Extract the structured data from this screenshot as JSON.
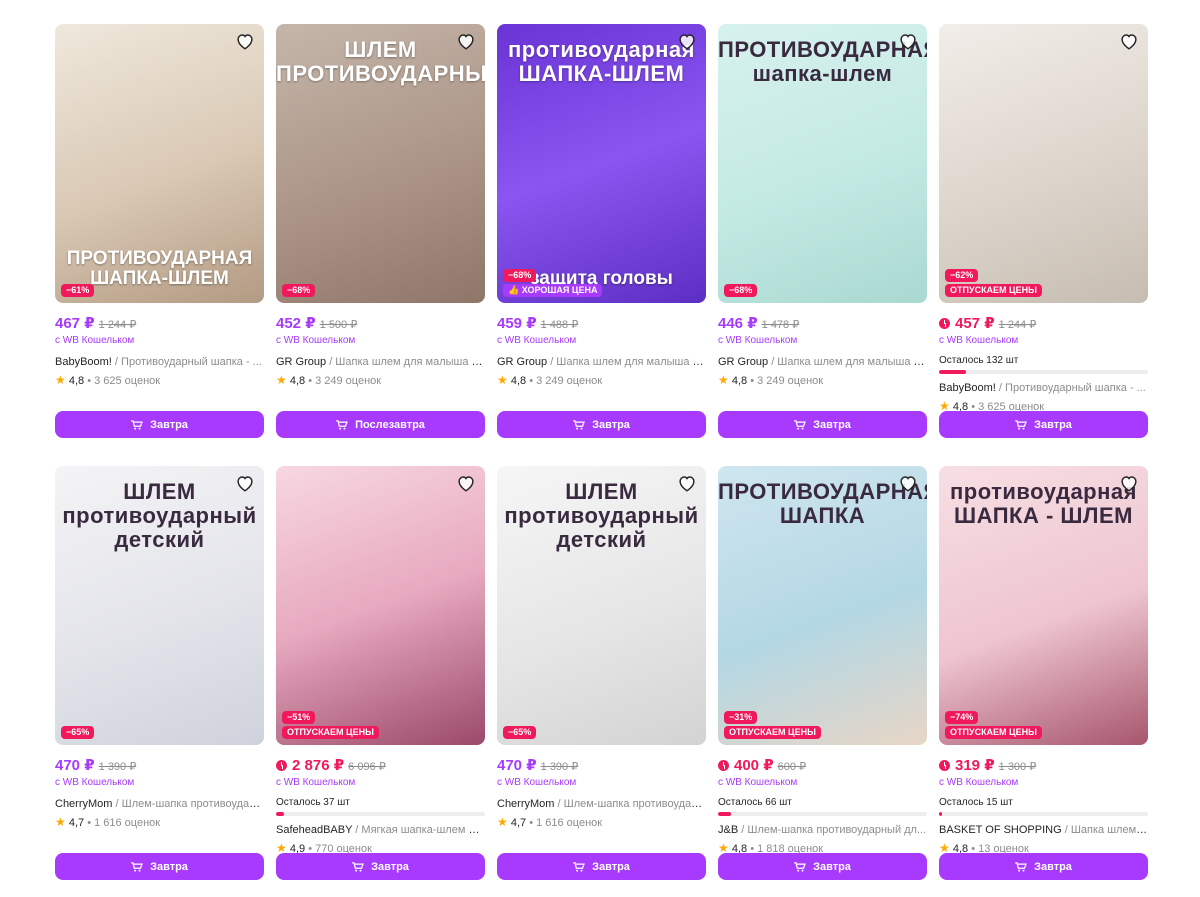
{
  "colors": {
    "accent": "#a73afd",
    "sale": "#f0195c",
    "muted": "#8c8c8c",
    "star": "#ffa800"
  },
  "rows": [
    [
      {
        "image": {
          "bg": "linear-gradient(160deg,#efe8dc 0%,#d9c8b4 55%,#b39a83 100%)",
          "text_top": "",
          "text_bottom": "ПРОТИВОУДАРНАЯ ШАПКА-ШЛЕМ",
          "dark": false
        },
        "badges": [
          {
            "text": "−61%",
            "style": "sale"
          }
        ],
        "price": "467 ₽",
        "old_price": "1 244 ₽",
        "price_style": "purple",
        "flash": false,
        "wallet": "с WB Кошельком",
        "stock": null,
        "brand": "BabyBoom!",
        "name": " / Противоударный шапка - ...",
        "rating": "4,8",
        "reviews": "3 625 оценок",
        "button": "Завтра"
      },
      {
        "image": {
          "bg": "linear-gradient(160deg,#c5b6aa 0%,#a99284 60%,#8e7668 100%)",
          "text_top": "ШЛЕМ ПРОТИВОУДАРНЫЙ",
          "text_bottom": "",
          "dark": false
        },
        "badges": [
          {
            "text": "−68%",
            "style": "sale"
          }
        ],
        "price": "452 ₽",
        "old_price": "1 500 ₽",
        "price_style": "purple",
        "flash": false,
        "wallet": "с WB Кошельком",
        "stock": null,
        "brand": "GR Group",
        "name": " / Шапка шлем для малыша пр...",
        "rating": "4,8",
        "reviews": "3 249 оценок",
        "button": "Послезавтра"
      },
      {
        "image": {
          "bg": "linear-gradient(160deg,#6a34d6 0%,#8a55f0 50%,#5d2ec4 100%)",
          "text_top": "противоударная ШАПКА-ШЛЕМ",
          "text_bottom": "защита головы",
          "dark": false
        },
        "badges": [
          {
            "text": "−68%",
            "style": "sale"
          },
          {
            "text": "👍 ХОРОШАЯ ЦЕНА",
            "style": "purple"
          }
        ],
        "price": "459 ₽",
        "old_price": "1 488 ₽",
        "price_style": "purple",
        "flash": false,
        "wallet": "с WB Кошельком",
        "stock": null,
        "brand": "GR Group",
        "name": " / Шапка шлем для малыша пр...",
        "rating": "4,8",
        "reviews": "3 249 оценок",
        "button": "Завтра"
      },
      {
        "image": {
          "bg": "linear-gradient(160deg,#d7f2ee 0%,#c3e9e3 55%,#a9d9d1 100%)",
          "text_top": "ПРОТИВОУДАРНАЯ шапка-шлем",
          "text_bottom": "",
          "dark": true
        },
        "badges": [
          {
            "text": "−68%",
            "style": "sale"
          }
        ],
        "price": "446 ₽",
        "old_price": "1 478 ₽",
        "price_style": "purple",
        "flash": false,
        "wallet": "с WB Кошельком",
        "stock": null,
        "brand": "GR Group",
        "name": " / Шапка шлем для малыша пр...",
        "rating": "4,8",
        "reviews": "3 249 оценок",
        "button": "Завтра"
      },
      {
        "image": {
          "bg": "linear-gradient(160deg,#f1ede8 0%,#ddd5cc 55%,#c6bcb1 100%)",
          "text_top": "",
          "text_bottom": "",
          "dark": false
        },
        "badges": [
          {
            "text": "−62%",
            "style": "sale"
          },
          {
            "text": "ОТПУСКАЕМ ЦЕНЫ",
            "style": "sale"
          }
        ],
        "price": "457 ₽",
        "old_price": "1 244 ₽",
        "price_style": "red",
        "flash": true,
        "wallet": "с WB Кошельком",
        "stock": {
          "text": "Осталось 132 шт",
          "fill": 0.13
        },
        "brand": "BabyBoom!",
        "name": " / Противоударный шапка - ...",
        "rating": "4,8",
        "reviews": "3 625 оценок",
        "button": "Завтра"
      }
    ],
    [
      {
        "image": {
          "bg": "linear-gradient(160deg,#f4f4f6 0%,#e3e4ea 55%,#cfd2dc 100%)",
          "text_top": "ШЛЕМ противоударный детский",
          "text_bottom": "",
          "dark": true
        },
        "badges": [
          {
            "text": "−65%",
            "style": "sale"
          }
        ],
        "price": "470 ₽",
        "old_price": "1 390 ₽",
        "price_style": "purple",
        "flash": false,
        "wallet": "с WB Кошельком",
        "stock": null,
        "brand": "CherryMom",
        "name": " / Шлем-шапка противоудар...",
        "rating": "4,7",
        "reviews": "1 616 оценок",
        "button": "Завтра"
      },
      {
        "image": {
          "bg": "linear-gradient(160deg,#f7d7e2 0%,#e7a9bf 50%,#9b4a6a 100%)",
          "text_top": "",
          "text_bottom": "",
          "dark": false
        },
        "badges": [
          {
            "text": "−51%",
            "style": "sale"
          },
          {
            "text": "ОТПУСКАЕМ ЦЕНЫ",
            "style": "sale"
          }
        ],
        "price": "2 876 ₽",
        "old_price": "6 096 ₽",
        "price_style": "red",
        "flash": true,
        "wallet": "с WB Кошельком",
        "stock": {
          "text": "Осталось 37 шт",
          "fill": 0.04
        },
        "brand": "SafeheadBABY",
        "name": " / Мягкая шапка-шлем дл...",
        "rating": "4,9",
        "reviews": "770 оценок",
        "button": "Завтра"
      },
      {
        "image": {
          "bg": "linear-gradient(160deg,#f6f6f6 0%,#e6e6e6 55%,#d3d3d3 100%)",
          "text_top": "ШЛЕМ противоударный детский",
          "text_bottom": "",
          "dark": true
        },
        "badges": [
          {
            "text": "−65%",
            "style": "sale"
          }
        ],
        "price": "470 ₽",
        "old_price": "1 390 ₽",
        "price_style": "purple",
        "flash": false,
        "wallet": "с WB Кошельком",
        "stock": null,
        "brand": "CherryMom",
        "name": " / Шлем-шапка противоудар...",
        "rating": "4,7",
        "reviews": "1 616 оценок",
        "button": "Завтра"
      },
      {
        "image": {
          "bg": "linear-gradient(160deg,#cfe6ef 0%,#b3d7e4 55%,#e7d6c6 100%)",
          "text_top": "ПРОТИВОУДАРНАЯ ШАПКА",
          "text_bottom": "",
          "dark": true
        },
        "badges": [
          {
            "text": "−31%",
            "style": "sale"
          },
          {
            "text": "ОТПУСКАЕМ ЦЕНЫ",
            "style": "sale"
          }
        ],
        "price": "400 ₽",
        "old_price": "600 ₽",
        "price_style": "red",
        "flash": true,
        "wallet": "с WB Кошельком",
        "stock": {
          "text": "Осталось 66 шт",
          "fill": 0.06
        },
        "brand": "J&B",
        "name": " / Шлем-шапка противоударный дл...",
        "rating": "4,8",
        "reviews": "1 818 оценок",
        "button": "Завтра"
      },
      {
        "image": {
          "bg": "linear-gradient(160deg,#f7dfe4 0%,#eec5cf 55%,#a7566e 100%)",
          "text_top": "противоударная ШАПКА - ШЛЕМ",
          "text_bottom": "",
          "dark": true
        },
        "badges": [
          {
            "text": "−74%",
            "style": "sale"
          },
          {
            "text": "ОТПУСКАЕМ ЦЕНЫ",
            "style": "sale"
          }
        ],
        "price": "319 ₽",
        "old_price": "1 300 ₽",
        "price_style": "red",
        "flash": true,
        "wallet": "с WB Кошельком",
        "stock": {
          "text": "Осталось 15 шт",
          "fill": 0.015
        },
        "brand": "BASKET OF SHOPPING",
        "name": " / Шапка шлем дл...",
        "rating": "4,8",
        "reviews": "13 оценок",
        "button": "Завтра"
      }
    ]
  ]
}
